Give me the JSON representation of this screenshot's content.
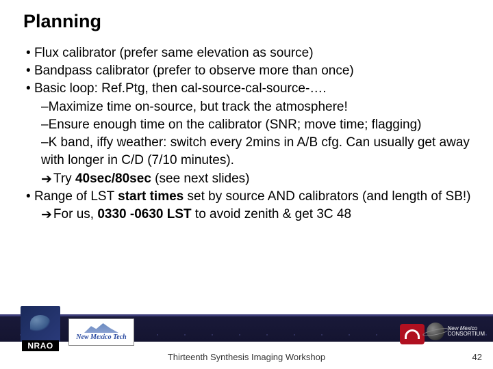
{
  "title": "Planning",
  "bullets": {
    "b1": "Flux calibrator (prefer same elevation as source)",
    "b2": "Bandpass calibrator (prefer to observe more than once)",
    "b3": "Basic loop: Ref.Ptg, then cal-source-cal-source-….",
    "b3a": "Maximize time on-source, but track the atmosphere!",
    "b3b": "Ensure enough time on the calibrator (SNR; move time; flagging)",
    "b3c": "K band, iffy weather: switch every 2mins in A/B cfg. Can usually get away with longer in C/D (7/10 minutes).",
    "b3d_pre": "Try ",
    "b3d_bold": "40sec/80sec",
    "b3d_post": " (see next slides)",
    "b4_pre": "Range of LST ",
    "b4_bold": "start times",
    "b4_post": " set by source AND calibrators (and length of SB!)",
    "b4a_pre": "For us, ",
    "b4a_bold": "0330 -0630 LST",
    "b4a_post": " to avoid zenith & get 3C 48"
  },
  "logos": {
    "nrao": "NRAO",
    "nmt_line1": "New Mexico Tech",
    "nm_consortium_l1": "New Mexico",
    "nm_consortium_l2": "CONSORTIUM"
  },
  "footer": "Thirteenth Synthesis Imaging Workshop",
  "page": "42",
  "arrow_glyph": "➔"
}
